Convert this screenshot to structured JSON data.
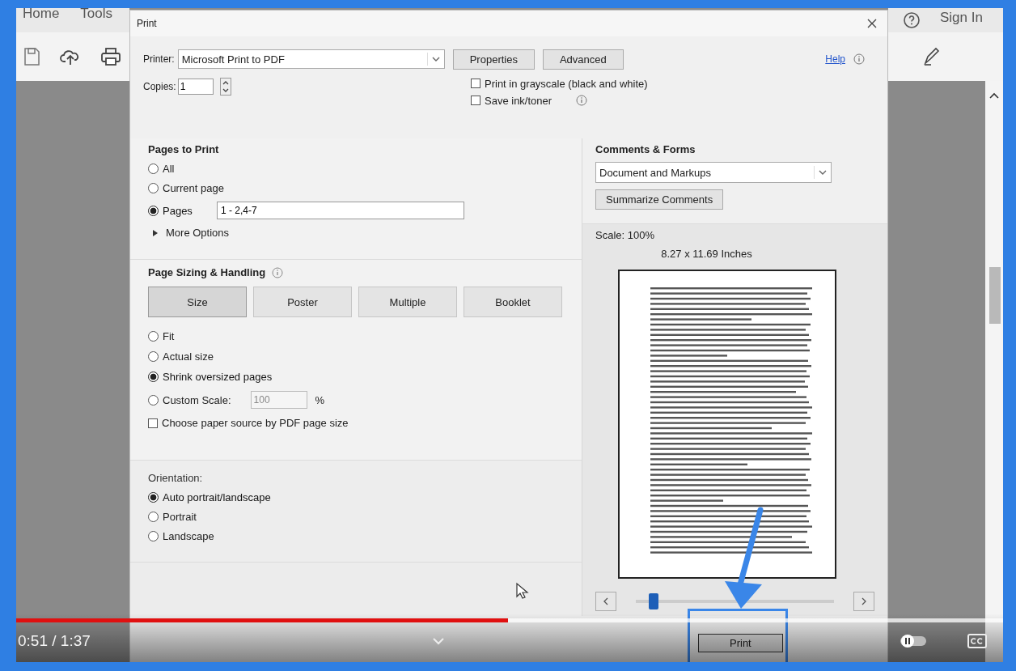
{
  "app": {
    "menu": [
      {
        "label": "Home"
      },
      {
        "label": "Tools"
      }
    ],
    "account": "Sign In"
  },
  "dialog": {
    "title": "Print",
    "printer": {
      "label": "Printer:",
      "value": "Microsoft Print to PDF"
    },
    "buttons": [
      "Properties",
      "Advanced"
    ],
    "help_link": "Help",
    "copies": {
      "label": "Copies:",
      "value": "1"
    },
    "options": [
      {
        "label": "Print in grayscale (black and white)",
        "checked": false
      },
      {
        "label": "Save ink/toner",
        "checked": false
      }
    ],
    "pages_to_print": {
      "title": "Pages to Print",
      "choices": [
        {
          "label": "All",
          "selected": false
        },
        {
          "label": "Current page",
          "selected": false
        },
        {
          "label": "Pages",
          "selected": true,
          "value": "1 - 2,4-7"
        }
      ],
      "more_options": {
        "label": "More Options",
        "expanded": false
      }
    },
    "page_sizing": {
      "title": "Page Sizing & Handling",
      "tabs": [
        {
          "label": "Size",
          "selected": true
        },
        {
          "label": "Poster",
          "selected": false
        },
        {
          "label": "Multiple",
          "selected": false
        },
        {
          "label": "Booklet",
          "selected": false
        }
      ],
      "choices": [
        {
          "label": "Fit",
          "selected": false
        },
        {
          "label": "Actual size",
          "selected": false
        },
        {
          "label": "Shrink oversized pages",
          "selected": true
        },
        {
          "label": "Custom Scale:",
          "selected": false,
          "value": "100",
          "unit": "%"
        }
      ],
      "paper_source": {
        "label": "Choose paper source by PDF page size",
        "checked": false
      }
    },
    "orientation": {
      "title": "Orientation:",
      "choices": [
        {
          "label": "Auto portrait/landscape",
          "selected": true
        },
        {
          "label": "Portrait",
          "selected": false
        },
        {
          "label": "Landscape",
          "selected": false
        }
      ]
    },
    "comments_forms": {
      "title": "Comments & Forms",
      "value": "Document and Markups",
      "button": "Summarize Comments"
    },
    "preview": {
      "scale": "Scale: 100%",
      "size": "8.27 x 11.69 Inches",
      "page_slider": {
        "level": 0.07
      }
    },
    "print_button": "Print"
  },
  "video": {
    "progress": {
      "level": 0.498
    },
    "time": "0:51 / 1:37"
  }
}
